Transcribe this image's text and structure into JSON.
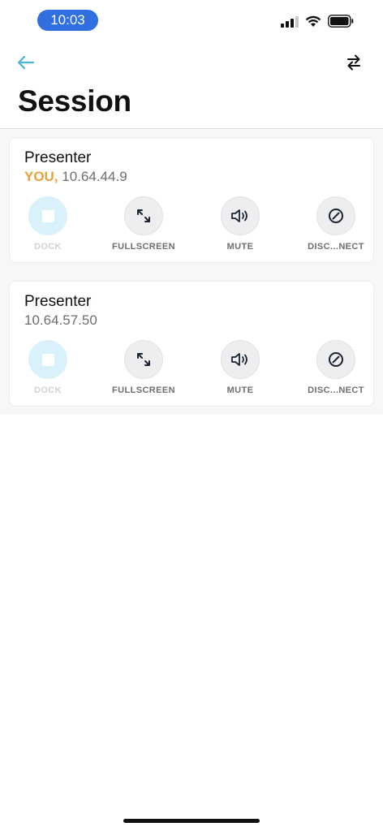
{
  "status": {
    "time": "10:03"
  },
  "nav": {
    "back_icon": "arrow-left-icon",
    "swap_icon": "swap-arrows-icon"
  },
  "page": {
    "title": "Session"
  },
  "colors": {
    "accent": "#4fb3d9",
    "you": "#e8a23a",
    "time_pill": "#2f6fe0"
  },
  "sessions": [
    {
      "title": "Presenter",
      "you_label": "YOU,",
      "address": "10.64.44.9",
      "actions": {
        "dock": "DOCK",
        "fullscreen": "FULLSCREEN",
        "mute": "MUTE",
        "disconnect": "DISC...NECT"
      }
    },
    {
      "title": "Presenter",
      "you_label": "",
      "address": "10.64.57.50",
      "actions": {
        "dock": "DOCK",
        "fullscreen": "FULLSCREEN",
        "mute": "MUTE",
        "disconnect": "DISC...NECT"
      }
    }
  ]
}
